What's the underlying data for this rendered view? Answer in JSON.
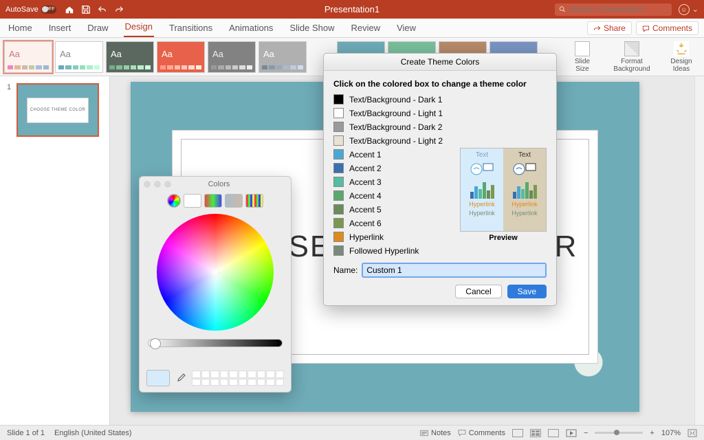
{
  "titlebar": {
    "autosave_label": "AutoSave",
    "autosave_state": "OFF",
    "document": "Presentation1",
    "search_placeholder": "Search in Presentation"
  },
  "tabs": {
    "items": [
      "Home",
      "Insert",
      "Draw",
      "Design",
      "Transitions",
      "Animations",
      "Slide Show",
      "Review",
      "View"
    ],
    "active_index": 3,
    "share": "Share",
    "comments": "Comments"
  },
  "ribbon_tools": {
    "size": "Slide\nSize",
    "format": "Format\nBackground",
    "ideas": "Design\nIdeas"
  },
  "thumbnail": {
    "number": "1",
    "title": "CHOOSE THEME COLOR"
  },
  "slide": {
    "title": "CHOOSE THEME COLOR"
  },
  "dialog": {
    "title": "Create Theme Colors",
    "instruction": "Click on the colored box to change a theme color",
    "rows": [
      {
        "label": "Text/Background - Dark 1",
        "color": "#000000"
      },
      {
        "label": "Text/Background - Light 1",
        "color": "#ffffff"
      },
      {
        "label": "Text/Background - Dark 2",
        "color": "#9a9a9a"
      },
      {
        "label": "Text/Background - Light 2",
        "color": "#e9e2d2"
      },
      {
        "label": "Accent 1",
        "color": "#4aa7d4"
      },
      {
        "label": "Accent 2",
        "color": "#3a6fb0"
      },
      {
        "label": "Accent 3",
        "color": "#55bda1"
      },
      {
        "label": "Accent 4",
        "color": "#5aa86b"
      },
      {
        "label": "Accent 5",
        "color": "#6a8b5a"
      },
      {
        "label": "Accent 6",
        "color": "#7a9950"
      },
      {
        "label": "Hyperlink",
        "color": "#e08a1e"
      },
      {
        "label": "Followed Hyperlink",
        "color": "#7a8a7a"
      }
    ],
    "preview_label": "Preview",
    "preview_text": "Text",
    "preview_hyper": "Hyperlink",
    "name_label": "Name:",
    "name_value": "Custom 1",
    "cancel": "Cancel",
    "save": "Save"
  },
  "colors_panel": {
    "title": "Colors"
  },
  "status": {
    "slide": "Slide 1 of 1",
    "lang": "English (United States)",
    "notes": "Notes",
    "comments": "Comments",
    "zoom": "107%"
  }
}
